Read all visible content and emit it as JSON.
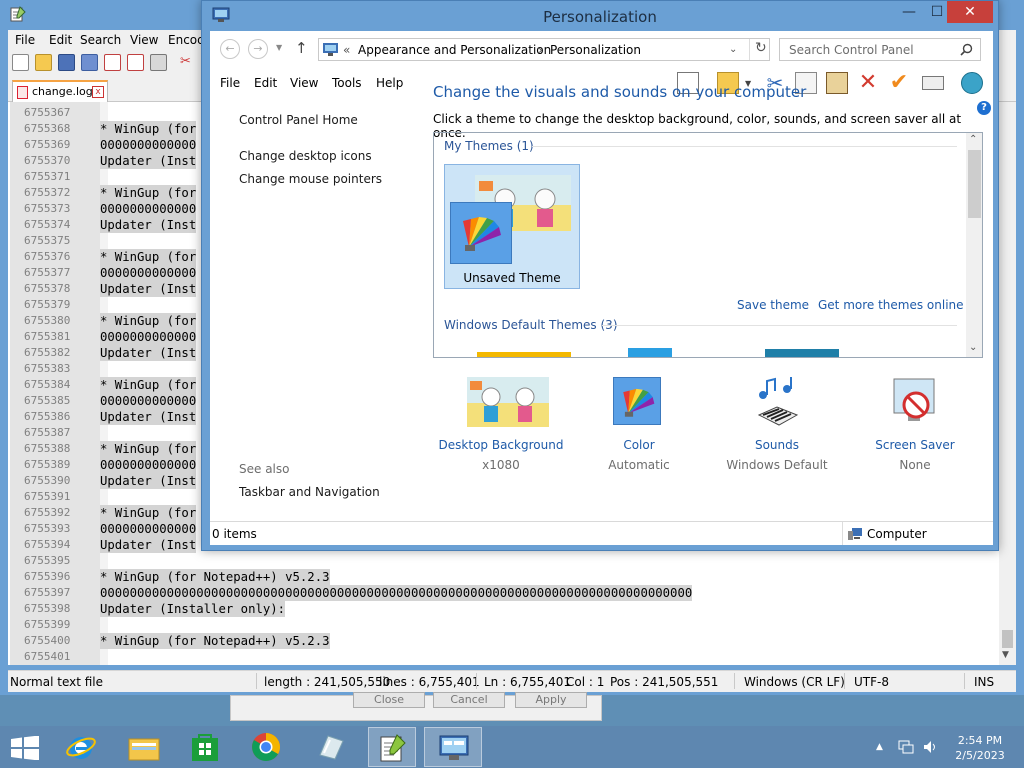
{
  "notepad": {
    "menu": [
      "File",
      "Edit",
      "Search",
      "View",
      "Encod"
    ],
    "tab_label": "change.log",
    "tab_close": "x",
    "lines": [
      {
        "num": "6755367",
        "text": ""
      },
      {
        "num": "6755368",
        "text": "* WinGup (for"
      },
      {
        "num": "6755369",
        "text": "0000000000000"
      },
      {
        "num": "6755370",
        "text": "Updater (Inst"
      },
      {
        "num": "6755371",
        "text": ""
      },
      {
        "num": "6755372",
        "text": "* WinGup (for"
      },
      {
        "num": "6755373",
        "text": "0000000000000"
      },
      {
        "num": "6755374",
        "text": "Updater (Inst"
      },
      {
        "num": "6755375",
        "text": ""
      },
      {
        "num": "6755376",
        "text": "* WinGup (for"
      },
      {
        "num": "6755377",
        "text": "0000000000000"
      },
      {
        "num": "6755378",
        "text": "Updater (Inst"
      },
      {
        "num": "6755379",
        "text": ""
      },
      {
        "num": "6755380",
        "text": "* WinGup (for"
      },
      {
        "num": "6755381",
        "text": "0000000000000"
      },
      {
        "num": "6755382",
        "text": "Updater (Inst"
      },
      {
        "num": "6755383",
        "text": ""
      },
      {
        "num": "6755384",
        "text": "* WinGup (for"
      },
      {
        "num": "6755385",
        "text": "0000000000000"
      },
      {
        "num": "6755386",
        "text": "Updater (Inst"
      },
      {
        "num": "6755387",
        "text": ""
      },
      {
        "num": "6755388",
        "text": "* WinGup (for"
      },
      {
        "num": "6755389",
        "text": "0000000000000"
      },
      {
        "num": "6755390",
        "text": "Updater (Inst"
      },
      {
        "num": "6755391",
        "text": ""
      },
      {
        "num": "6755392",
        "text": "* WinGup (for"
      },
      {
        "num": "6755393",
        "text": "0000000000000"
      },
      {
        "num": "6755394",
        "text": "Updater (Inst"
      },
      {
        "num": "6755395",
        "text": ""
      },
      {
        "num": "6755396",
        "text": "* WinGup (for Notepad++) v5.2.3"
      },
      {
        "num": "6755397",
        "text": "00000000000000000000000000000000000000000000000000000000000000000000000000000000"
      },
      {
        "num": "6755398",
        "text": "Updater (Installer only):"
      },
      {
        "num": "6755399",
        "text": ""
      },
      {
        "num": "6755400",
        "text": "* WinGup (for Notepad++) v5.2.3"
      },
      {
        "num": "6755401",
        "text": ""
      }
    ],
    "status": {
      "type": "Normal text file",
      "length": "length : 241,505,550",
      "lines": "lines : 6,755,401",
      "ln": "Ln : 6,755,401",
      "col": "Col : 1",
      "pos": "Pos : 241,505,551",
      "eol": "Windows (CR LF)",
      "encoding": "UTF-8",
      "mode": "INS"
    }
  },
  "ghost_dialog": {
    "buttons": [
      "Close",
      "Cancel",
      "Apply"
    ]
  },
  "personalization": {
    "title": "Personalization",
    "caption_buttons": {
      "minimize": "—",
      "maximize": "☐",
      "close": "✕"
    },
    "breadcrumb": {
      "prefix": "«",
      "part1": "Appearance and Personalization",
      "part2": "Personalization",
      "sep": "›"
    },
    "search_placeholder": "Search Control Panel",
    "menu": [
      "File",
      "Edit",
      "View",
      "Tools",
      "Help"
    ],
    "sidebar": {
      "home": "Control Panel Home",
      "links": [
        "Change desktop icons",
        "Change mouse pointers"
      ],
      "see_also": "See also",
      "see_also_links": [
        "Taskbar and Navigation"
      ]
    },
    "heading": "Change the visuals and sounds on your computer",
    "subheading": "Click a theme to change the desktop background, color, sounds, and screen saver all at once.",
    "my_themes_label": "My Themes (1)",
    "unsaved_theme_label": "Unsaved Theme",
    "save_theme": "Save theme",
    "get_more_themes": "Get more themes online",
    "windows_default_label": "Windows Default Themes (3)",
    "bottom_items": [
      {
        "name": "Desktop Background",
        "sub": "x1080",
        "icon": "desktop-background-icon"
      },
      {
        "name": "Color",
        "sub": "Automatic",
        "icon": "color-palette-icon"
      },
      {
        "name": "Sounds",
        "sub": "Windows Default",
        "icon": "sounds-icon"
      },
      {
        "name": "Screen Saver",
        "sub": "None",
        "icon": "screen-saver-icon"
      }
    ],
    "status_items": "0 items",
    "status_location": "Computer"
  },
  "taskbar": {
    "time": "2:54 PM",
    "date": "2/5/2023"
  }
}
